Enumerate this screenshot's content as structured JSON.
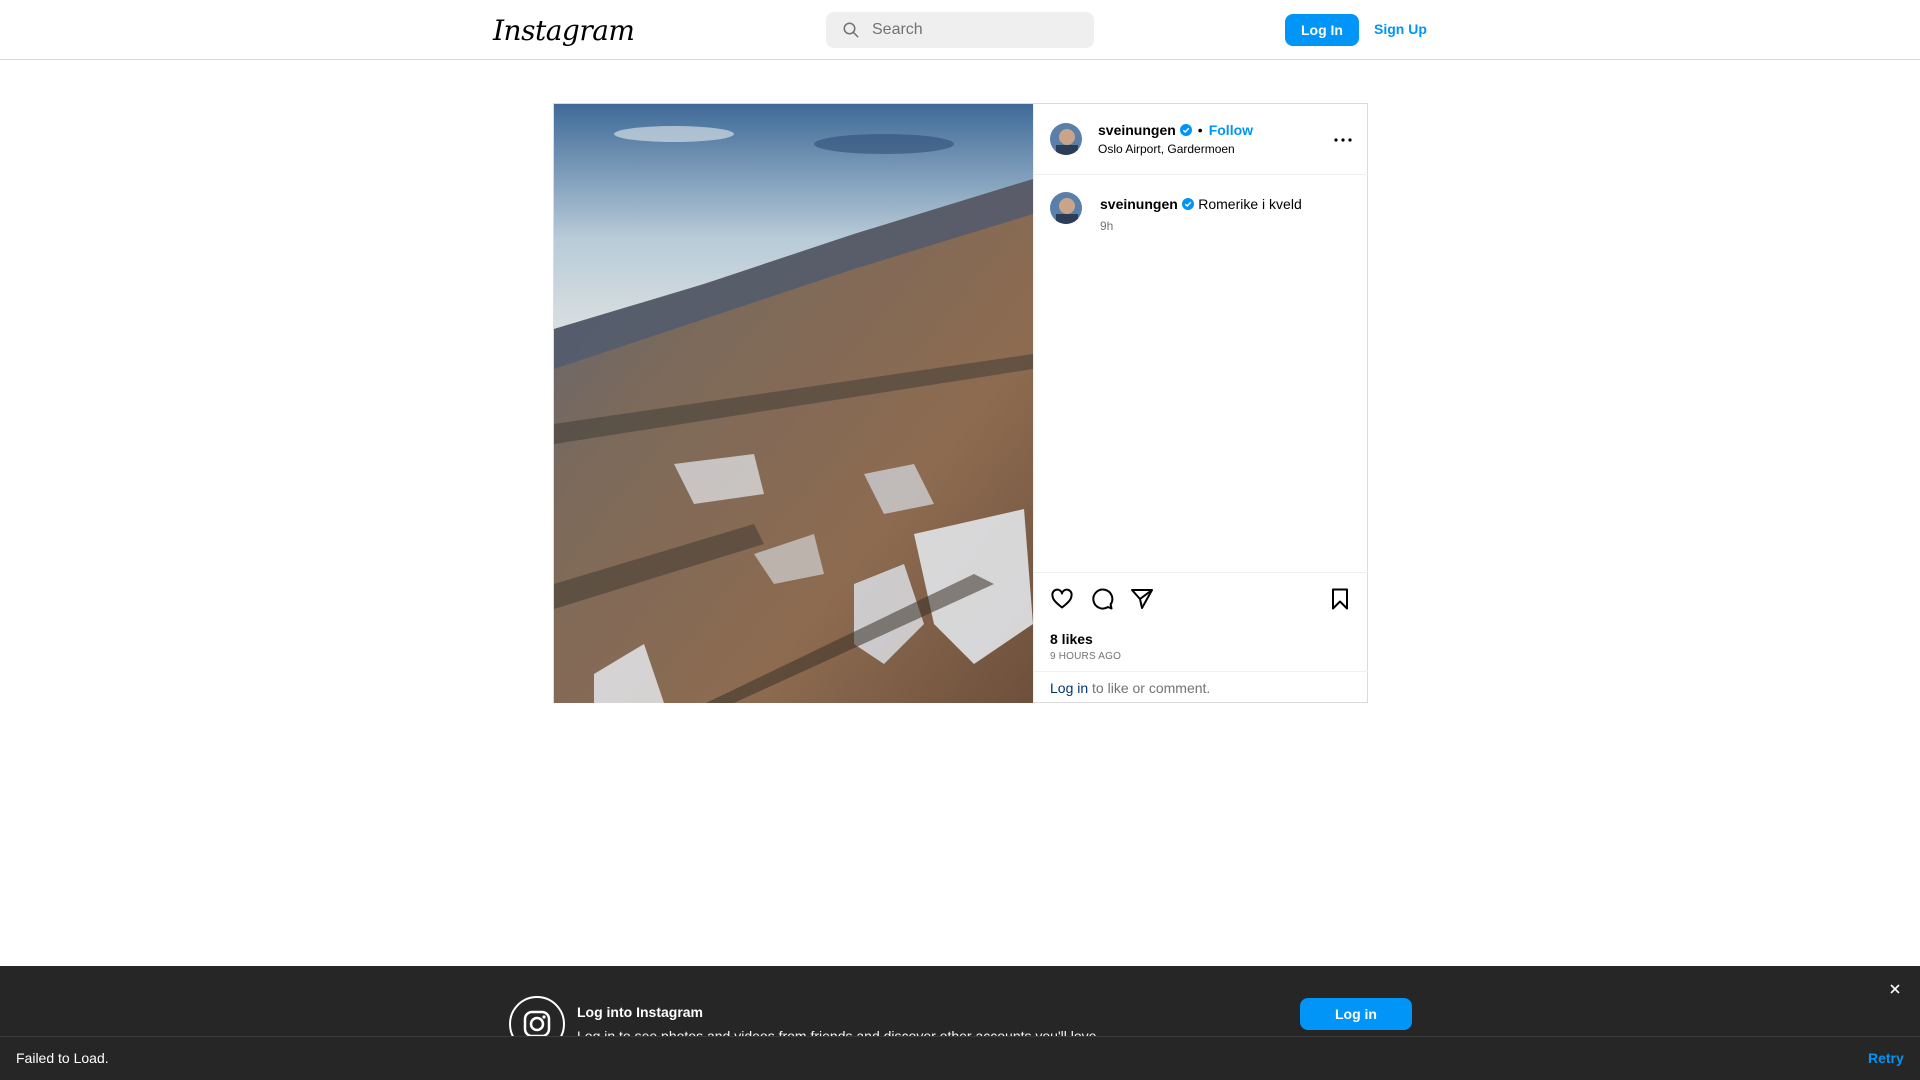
{
  "nav": {
    "logo": "Instagram",
    "search_placeholder": "Search",
    "login_label": "Log In",
    "signup_label": "Sign Up"
  },
  "post": {
    "author": {
      "username": "sveinungen",
      "verified": true,
      "follow_label": "Follow",
      "separator": "•",
      "location": "Oslo Airport, Gardermoen"
    },
    "caption": {
      "username": "sveinungen",
      "text": "Romerike i kveld",
      "time": "9h"
    },
    "likes": "8 likes",
    "time_ago": "9 HOURS AGO",
    "login_prompt": {
      "link": "Log in",
      "text": " to like or comment."
    },
    "icons": [
      "like-heart-icon",
      "comment-icon",
      "share-icon",
      "save-bookmark-icon",
      "more-options-icon"
    ]
  },
  "banner": {
    "title": "Log into Instagram",
    "subtitle": "Log in to see photos and videos from friends and discover other accounts you'll love.",
    "login_label": "Log in"
  },
  "fail": {
    "message": "Failed to Load.",
    "retry_label": "Retry"
  },
  "colors": {
    "accent": "#0095f6",
    "border": "#dbdbdb",
    "banner_bg": "#262626",
    "link_dark": "#00376b"
  }
}
